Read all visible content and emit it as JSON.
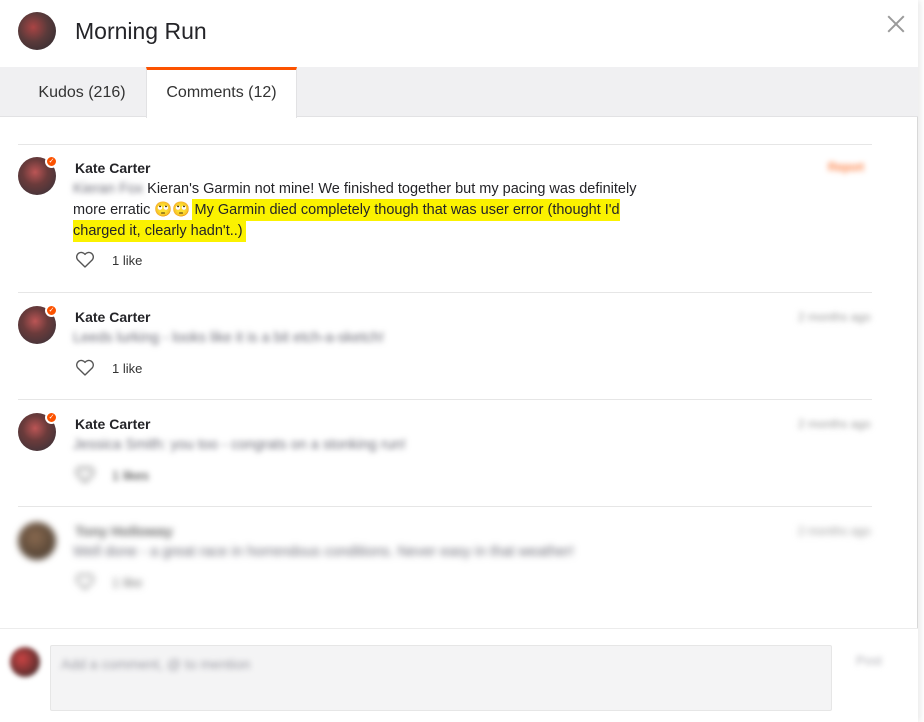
{
  "header": {
    "title": "Morning Run"
  },
  "tabs": [
    {
      "label": "Kudos (216)"
    },
    {
      "label": "Comments (12)"
    }
  ],
  "comments": [
    {
      "author": "Kate Carter",
      "mention": "Kieran",
      "text_plain": "Kieran's Garmin not mine! We finished together but my pacing was definitely more erratic 🙄🙄",
      "text_highlighted": "My Garmin died completely though that was user error (thought I'd charged it, clearly hadn't..)",
      "likes": "1 like",
      "date": "Report"
    },
    {
      "author": "Kate Carter",
      "text": "Leeds lurking - looks like it is a bit etch-a-sketch!",
      "likes": "1 like",
      "date": "2 months ago"
    },
    {
      "author": "Kate Carter",
      "text": "Jessica Smith: you too - congrats on a stonking run!",
      "likes": "1 likes",
      "date": "2 months ago"
    },
    {
      "author": "Tony Holloway",
      "text": "Well done - a great race in horrendous conditions. Never easy in that weather!",
      "likes": "1 like",
      "date": "2 months ago"
    }
  ],
  "composer": {
    "placeholder": "Add a comment, @ to mention",
    "post_label": "Post"
  },
  "colors": {
    "accent": "#fc5200",
    "highlight": "#fbf200"
  }
}
